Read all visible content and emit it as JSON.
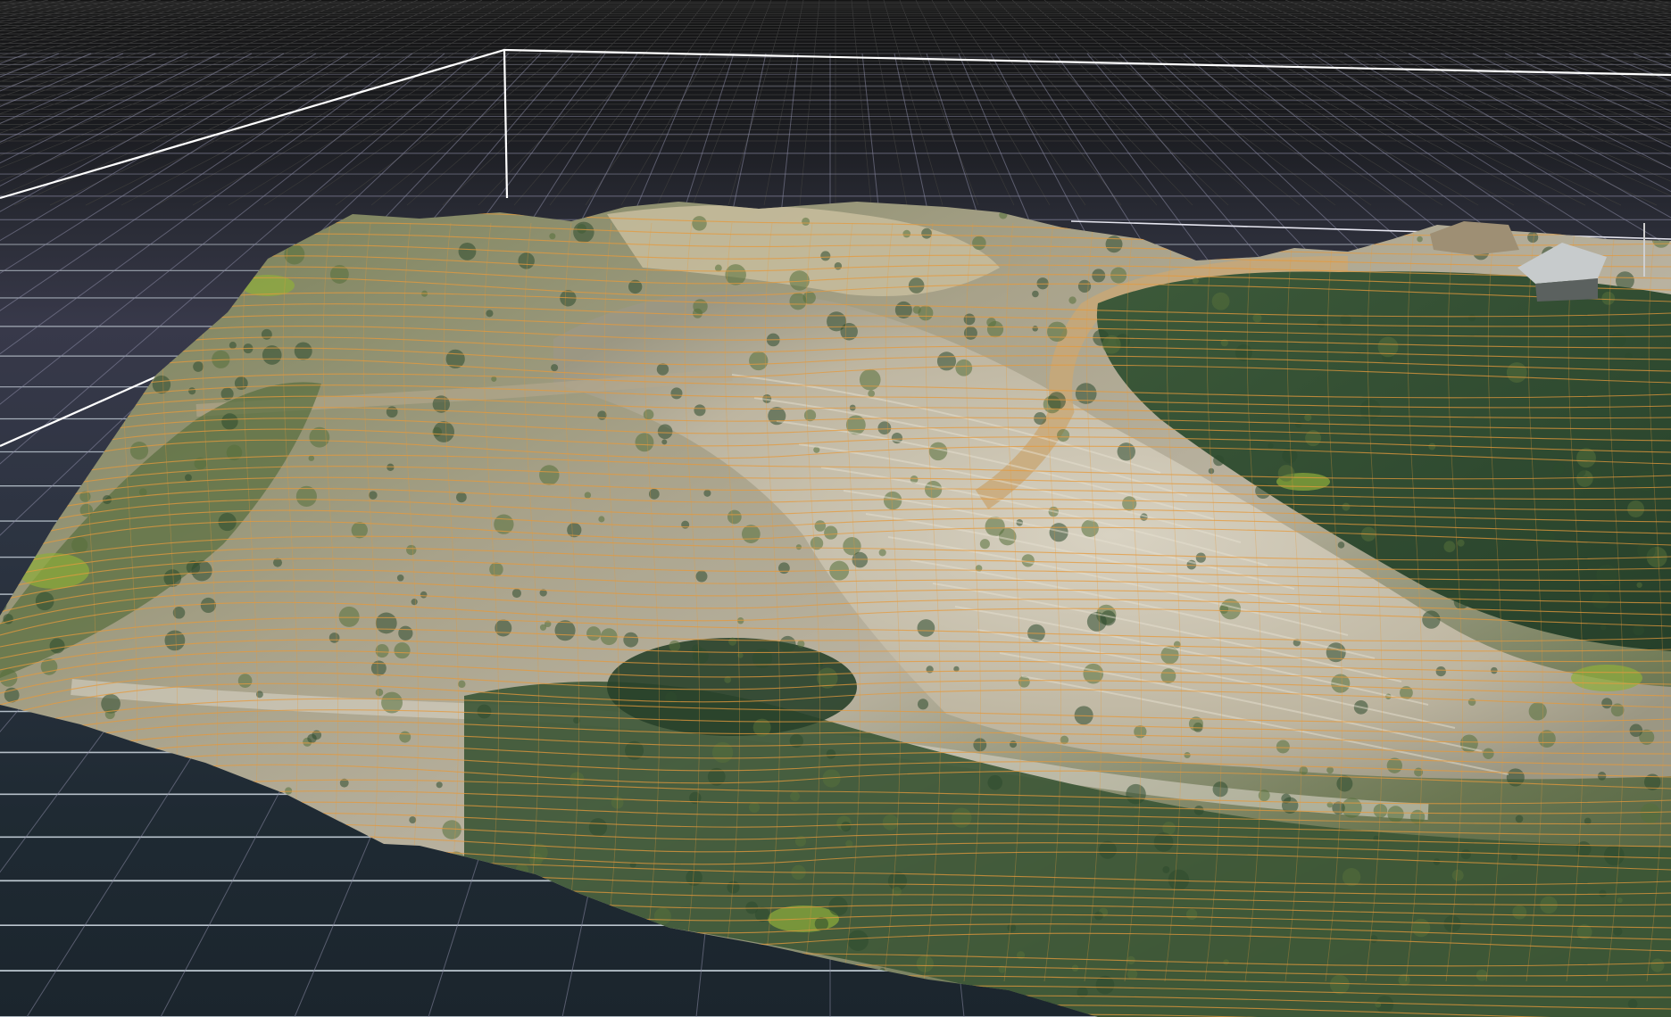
{
  "viewport": {
    "view": "3d-perspective",
    "layers": [
      "grid-floor",
      "bounding-box",
      "terrain-mesh",
      "contour-lines"
    ]
  },
  "colors": {
    "background_top": "#141414",
    "grid_far": "#3a3a3a",
    "grid_mid": "#8a8aa4",
    "grid_near": "#c9d3dc",
    "bounding_box": "#ffffff",
    "contour": "#e69a3c",
    "vegetation_dark": "#2f4a2c",
    "vegetation_light": "#6b8a3a",
    "quarry_rock": "#c9c2b0",
    "quarry_sand": "#c9a775"
  }
}
